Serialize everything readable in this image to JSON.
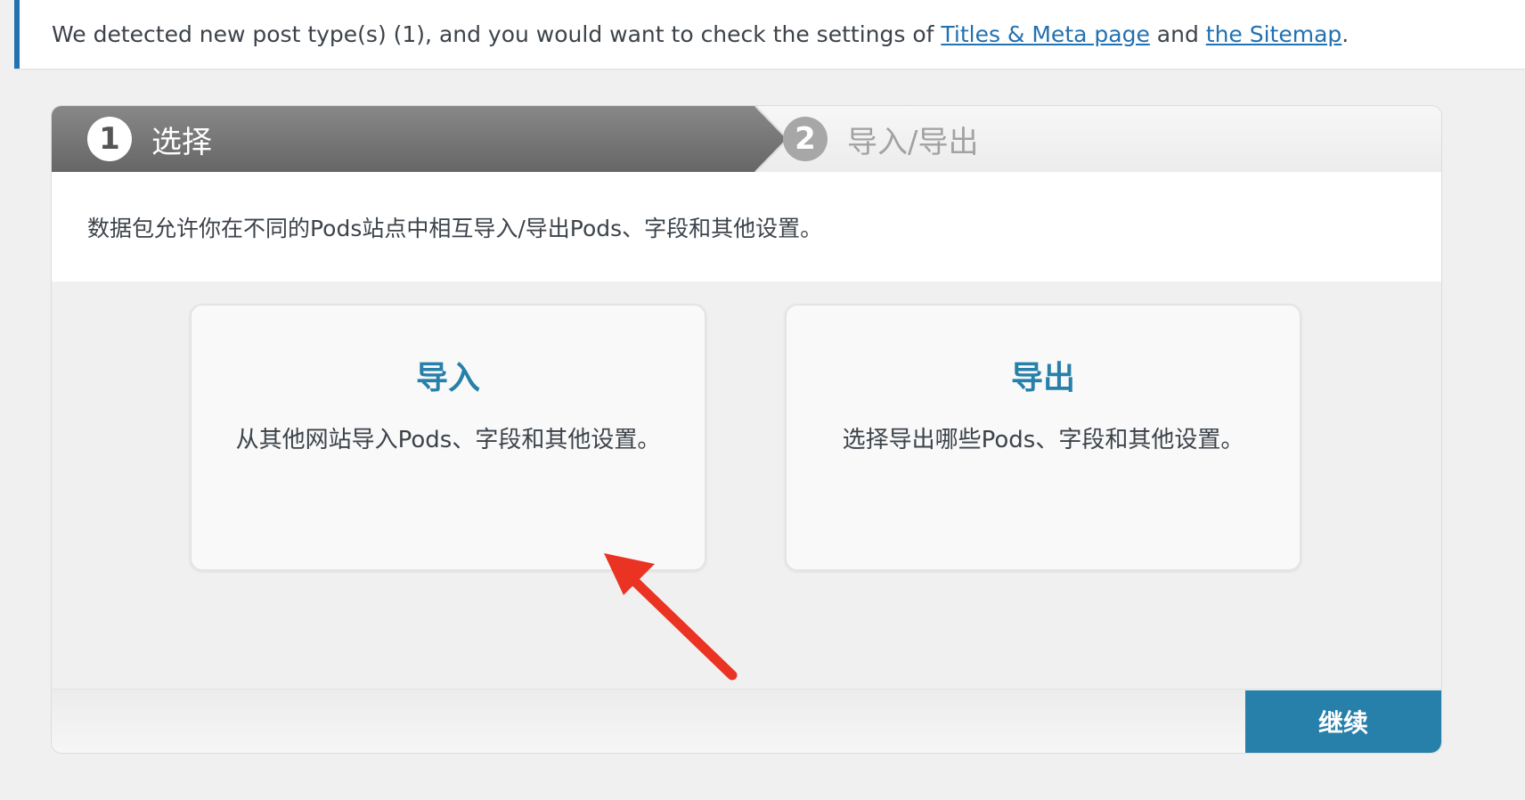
{
  "notice": {
    "text_before": "We detected new post type(s) (1), and you would want to check the settings of ",
    "link1": "Titles & Meta page",
    "text_middle": " and ",
    "link2": "the Sitemap",
    "text_after": "."
  },
  "steps": [
    {
      "number": "1",
      "label": "选择",
      "active": true
    },
    {
      "number": "2",
      "label": "导入/导出",
      "active": false
    }
  ],
  "intro": "数据包允许你在不同的Pods站点中相互导入/导出Pods、字段和其他设置。",
  "options": {
    "import": {
      "title": "导入",
      "description": "从其他网站导入Pods、字段和其他设置。"
    },
    "export": {
      "title": "导出",
      "description": "选择导出哪些Pods、字段和其他设置。"
    }
  },
  "footer": {
    "continue_label": "继续"
  },
  "colors": {
    "accent": "#2680aa",
    "notice_border": "#2271b1",
    "annotation": "#ea3323"
  }
}
